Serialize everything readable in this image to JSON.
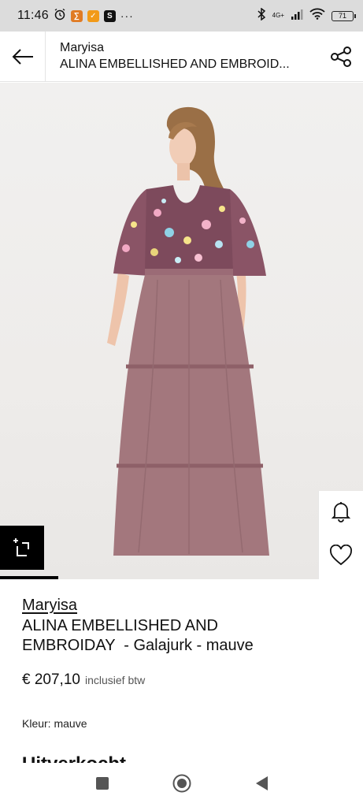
{
  "status_bar": {
    "time": "11:46",
    "network": "4G+",
    "battery": "71",
    "more": "···"
  },
  "header": {
    "brand": "Maryisa",
    "product_title": "ALINA EMBELLISHED AND EMBROID..."
  },
  "product": {
    "brand": "Maryisa",
    "name_line1": "ALINA EMBELLISHED AND",
    "name_line2": "EMBROIDAY  - Galajurk - mauve",
    "price": "€ 207,10",
    "vat_note": "inclusief btw",
    "color_label": "Kleur: mauve",
    "availability": "Uitverkocht"
  },
  "image": {
    "background": "#efedeb",
    "dress_color": "#9e7278",
    "gallery_progress": 0.16
  },
  "colors": {
    "accent": "#000000",
    "statusbar": "#dcdcdc"
  }
}
